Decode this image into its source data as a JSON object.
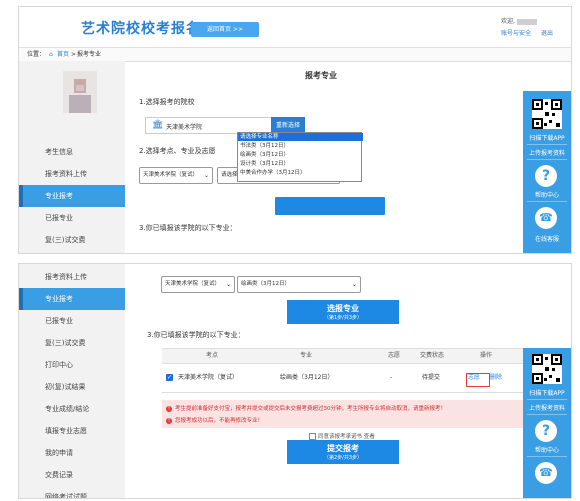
{
  "header": {
    "site_title": "艺术院校校考报名",
    "home_button": "返回首页 >>",
    "welcome": "欢迎,",
    "account_link": "账号与安全",
    "logout_link": "退出"
  },
  "breadcrumb": {
    "prefix": "位置：",
    "home": "首页",
    "sep": ">",
    "current": "报考专业"
  },
  "sidebar": {
    "top": [
      "考生信息",
      "报考资料上传",
      "专业报考",
      "已报专业",
      "复(三)试交费"
    ],
    "bottom": [
      "报考资料上传",
      "专业报考",
      "已报专业",
      "复(三)试交费",
      "打印中心",
      "初(复)试结果",
      "专业成绩/结论",
      "填报专业志愿",
      "我的申请",
      "交费记录",
      "网络考试试题"
    ]
  },
  "main": {
    "title": "报考专业",
    "step1": "1.选择报考的院校",
    "university": "天津美术学院",
    "reselect": "重新选择",
    "step2": "2.选择考点、专业及志愿",
    "exam_site_select": "天津美术学院（复试）",
    "major_select_placeholder": "请选择专业名称",
    "major_options": [
      "请选择专业名称",
      "书法类（3月12日）",
      "绘画类（3月12日）",
      "设计类（3月12日）",
      "中美合作办学（3月12日）"
    ],
    "major_selected": "绘画类（3月12日）",
    "select_major_btn": {
      "label": "选报专业",
      "sub": "（第1步/共3步）"
    },
    "step3": "3.你已填报该学院的以下专业：",
    "table": {
      "headers": [
        "考点",
        "专业",
        "志愿",
        "交费状态",
        "操作"
      ],
      "row": {
        "site": "天津美术学院（复试）",
        "major": "绘画类（3月12日）",
        "wish": "-",
        "status": "待提交",
        "action_wish": "志愿",
        "action_delete": "删除"
      }
    },
    "warnings": [
      "考生提前准备好支付宝，报考并提交或提交后未交报考费超过30分钟，考生所报专业将自动取消，请重新报考！",
      "您报考成功以后，不能再修改专业！"
    ],
    "agreement": "同意该报考承诺书 查看",
    "submit_btn": {
      "label": "提交报考",
      "sub": "（第2步/共3步）"
    }
  },
  "float_bar": {
    "app_download": "扫描下载APP",
    "upload": "上传报考资料",
    "help": "帮助中心",
    "service": "在线客服"
  },
  "colors": {
    "brand_blue": "#3a9ee4",
    "title_blue": "#2a7fd4",
    "warning_red": "#d32f2f"
  }
}
